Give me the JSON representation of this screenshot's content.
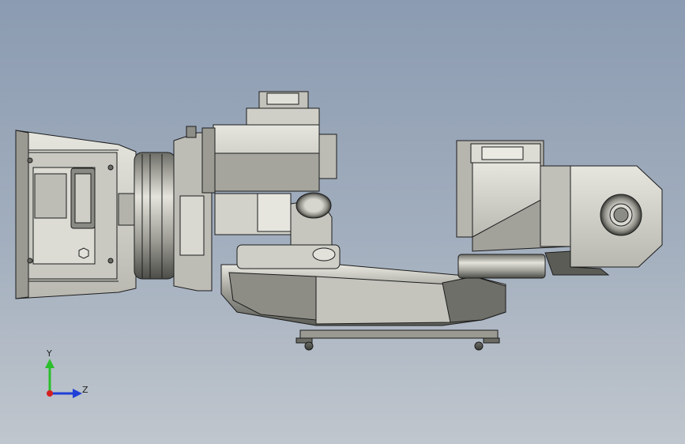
{
  "viewport": {
    "background_top": "#8b9bb1",
    "background_bottom": "#c0c6cd"
  },
  "model": {
    "part_color_light": "#d9d9d2",
    "part_color_mid": "#a9a9a2",
    "part_color_dark": "#4a4a46",
    "edge_color": "#1c1c1c"
  },
  "triad": {
    "y_label": "Y",
    "z_label": "Z",
    "y_color": "#2bbf2b",
    "z_color": "#1f3fd6",
    "x_color": "#d61f1f"
  }
}
